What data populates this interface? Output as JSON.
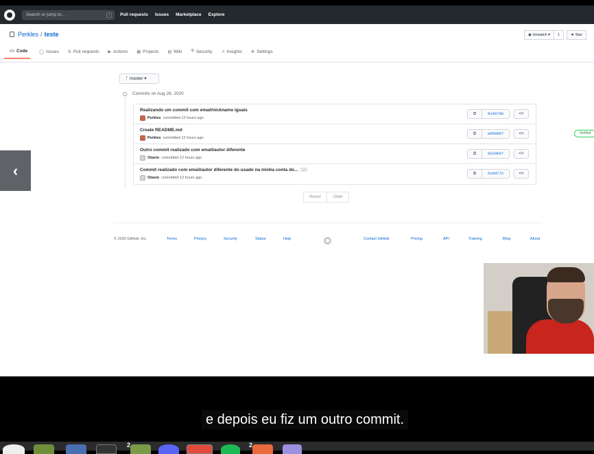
{
  "github": {
    "search_placeholder": "Search or jump to...",
    "search_shortcut": "/",
    "nav": [
      "Pull requests",
      "Issues",
      "Marketplace",
      "Explore"
    ]
  },
  "repo": {
    "owner": "Perkles",
    "separator": "/",
    "name": "teste",
    "watch_label": "Unwatch",
    "watch_count": "1",
    "star_label": "Star"
  },
  "tabs": [
    {
      "icon": "<>",
      "label": "Code"
    },
    {
      "icon": "◯",
      "label": "Issues"
    },
    {
      "icon": "⇅",
      "label": "Pull requests"
    },
    {
      "icon": "▶",
      "label": "Actions"
    },
    {
      "icon": "▦",
      "label": "Projects"
    },
    {
      "icon": "▤",
      "label": "Wiki"
    },
    {
      "icon": "⛨",
      "label": "Security"
    },
    {
      "icon": "↗",
      "label": "Insights"
    },
    {
      "icon": "⚙",
      "label": "Settings"
    }
  ],
  "branch": {
    "icon": "ᚴ",
    "label": "master"
  },
  "commits_date": "Commits on Aug 26, 2020",
  "commits": [
    {
      "title": "Realizando um commit com email/nickname iguais",
      "author": "Perkles",
      "meta": "committed 12 hours ago",
      "sha": "0148798",
      "verified": "",
      "truncated": ""
    },
    {
      "title": "Create README.md",
      "author": "Perkles",
      "meta": "committed 12 hours ago",
      "sha": "a050887",
      "verified": "Verified",
      "truncated": ""
    },
    {
      "title": "Outro commit realizado com email/autor diferente",
      "author": "Otavio",
      "meta": "committed 12 hours ago",
      "sha": "9229b87",
      "verified": "",
      "truncated": ""
    },
    {
      "title": "Commit realizado com email/autor diferente do usado na minha conta do...",
      "author": "Otavio",
      "meta": "committed 12 hours ago",
      "sha": "5c8d772",
      "verified": "",
      "truncated": "..."
    }
  ],
  "pager": {
    "newer": "Newer",
    "older": "Older"
  },
  "footer": {
    "copyright": "© 2020 GitHub, Inc.",
    "left_links": [
      "Terms",
      "Privacy",
      "Security",
      "Status",
      "Help"
    ],
    "right_links": [
      "Contact GitHub",
      "Pricing",
      "API",
      "Training",
      "Blog",
      "About"
    ]
  },
  "subtitle": "e depois eu fiz um outro commit.",
  "dock": {
    "badges": [
      "2",
      "2"
    ]
  },
  "colors": {
    "header_bg": "#24292e",
    "link": "#0366d6",
    "tab_active_underline": "#f9826c",
    "verified": "#22863a"
  }
}
